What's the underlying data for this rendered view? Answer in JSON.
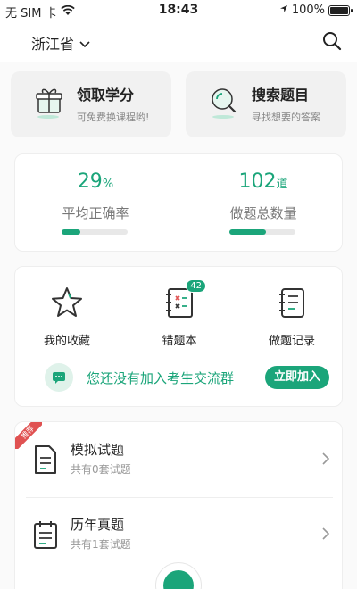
{
  "status_bar": {
    "carrier": "无 SIM 卡",
    "time": "18:43",
    "battery": "100%"
  },
  "header": {
    "province": "浙江省"
  },
  "quick_actions": [
    {
      "title": "领取学分",
      "subtitle": "可免费换课程哟!"
    },
    {
      "title": "搜索题目",
      "subtitle": "寻找想要的答案"
    }
  ],
  "stats": {
    "accuracy": {
      "value": "29",
      "unit": "%",
      "label": "平均正确率",
      "fraction": 0.29
    },
    "count": {
      "value": "102",
      "unit": "道",
      "label": "做题总数量",
      "fraction": 0.55
    }
  },
  "tools": [
    {
      "label": "我的收藏",
      "icon": "star-icon"
    },
    {
      "label": "错题本",
      "icon": "wrong-book-icon",
      "badge": "42"
    },
    {
      "label": "做题记录",
      "icon": "record-icon"
    }
  ],
  "group": {
    "text": "您还没有加入考生交流群",
    "button": "立即加入"
  },
  "list": [
    {
      "ribbon": "推荐",
      "title": "模拟试题",
      "subtitle": "共有0套试题"
    },
    {
      "title": "历年真题",
      "subtitle": "共有1套试题"
    }
  ],
  "colors": {
    "accent": "#1ba57a",
    "ribbon": "#e05252"
  }
}
